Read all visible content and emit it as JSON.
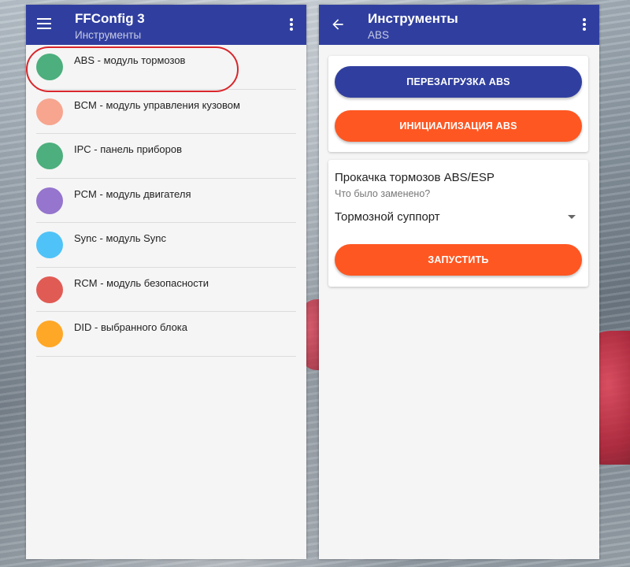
{
  "colors": {
    "appbar": "#303f9f",
    "primary_button": "#303f9f",
    "accent_button": "#ff5722",
    "highlight_ring": "#d9262b"
  },
  "left_screen": {
    "title": "FFConfig 3",
    "subtitle": "Инструменты",
    "menu_icon": "hamburger-menu-icon",
    "overflow_icon": "more-vert-icon",
    "modules": [
      {
        "label": "ABS - модуль тормозов",
        "color": "#4caf7d",
        "highlighted": true
      },
      {
        "label": "BCM - модуль управления кузовом",
        "color": "#f7a58f",
        "highlighted": false
      },
      {
        "label": "IPC - панель приборов",
        "color": "#4caf7d",
        "highlighted": false
      },
      {
        "label": "PCM - модуль двигателя",
        "color": "#9575cd",
        "highlighted": false
      },
      {
        "label": "Sync - модуль Sync",
        "color": "#4fc3f7",
        "highlighted": false
      },
      {
        "label": "RCM - модуль безопасности",
        "color": "#e15b55",
        "highlighted": false
      },
      {
        "label": "DID - выбранного блока",
        "color": "#ffa726",
        "highlighted": false
      }
    ]
  },
  "right_screen": {
    "title": "Инструменты",
    "subtitle": "ABS",
    "back_icon": "arrow-back-icon",
    "overflow_icon": "more-vert-icon",
    "reset_button": "ПЕРЕЗАГРУЗКА ABS",
    "init_button": "ИНИЦИАЛИЗАЦИЯ ABS",
    "bleed": {
      "title": "Прокачка тормозов ABS/ESP",
      "question": "Что было заменено?",
      "selected": "Тормозной суппорт",
      "run_button": "ЗАПУСТИТЬ"
    }
  }
}
